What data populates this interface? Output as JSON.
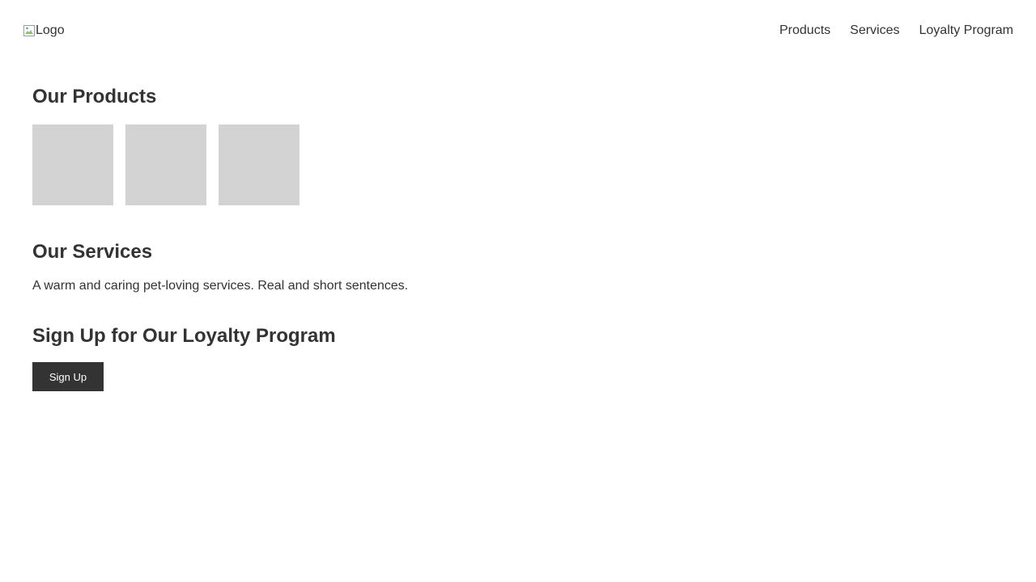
{
  "header": {
    "logo_alt": "Logo",
    "nav": [
      {
        "label": "Products"
      },
      {
        "label": "Services"
      },
      {
        "label": "Loyalty Program"
      }
    ]
  },
  "products": {
    "title": "Our Products",
    "tile_color": "#d3d3d3"
  },
  "services": {
    "title": "Our Services",
    "text": "A warm and caring pet-loving services. Real and short sentences."
  },
  "loyalty": {
    "title": "Sign Up for Our Loyalty Program",
    "button_label": "Sign Up"
  },
  "colors": {
    "text": "#333333",
    "button_bg": "#333333",
    "button_text": "#ffffff"
  }
}
